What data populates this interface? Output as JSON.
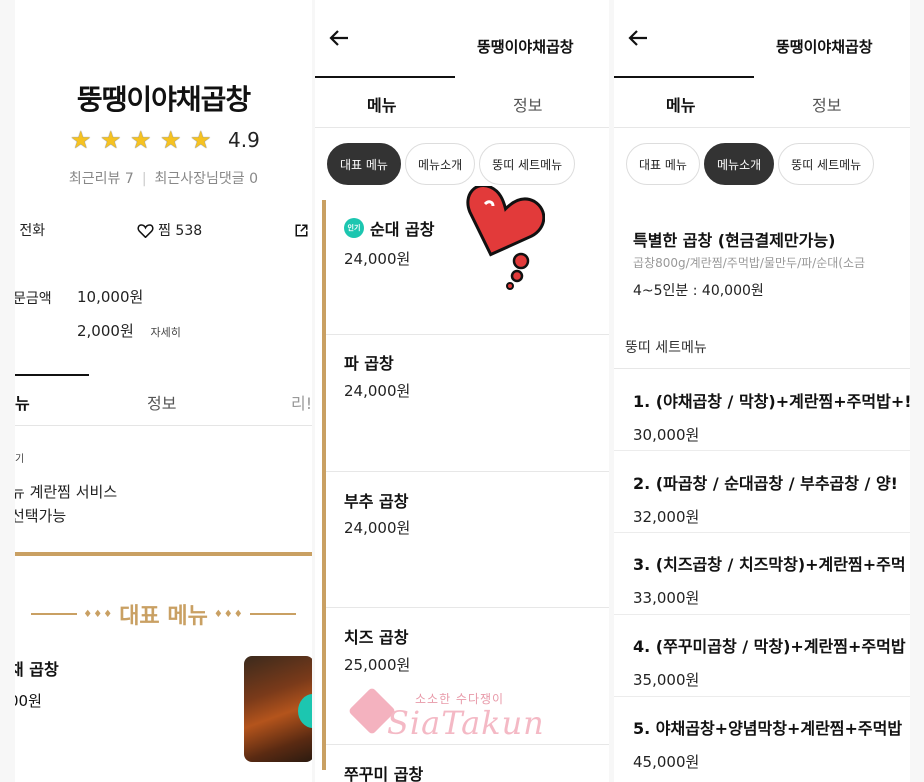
{
  "panel1": {
    "store_title": "뚱땡이야채곱창",
    "rating_score": "4.9",
    "stars": 5,
    "recent_reviews": "최근리뷰 7",
    "owner_comments": "최근사장님댓글 0",
    "actions": {
      "call": "전화",
      "favorite": "찜 538",
      "share": "공"
    },
    "min_order_label": "문금액",
    "min_order_value": "10,000원",
    "delivery_fee": "2,000원",
    "detail_label": "자세히",
    "tabs": [
      "뉴",
      "정보",
      "리!"
    ],
    "notice_small": "기",
    "notice_line1": "뉴 계란찜 서비스",
    "notice_line2": "선택가능",
    "banner_dots_left": "♦♦♦",
    "banner_title": "대표 메뉴",
    "banner_dots_right": "♦♦♦",
    "menu_item_name": "채 곱창",
    "menu_item_price": "00원"
  },
  "panel2": {
    "header_title": "뚱땡이야채곱창",
    "tabs": [
      "메뉴",
      "정보"
    ],
    "chips": [
      "대표 메뉴",
      "메뉴소개",
      "뚱띠 세트메뉴"
    ],
    "selected_chip": 0,
    "popular_badge": "인기",
    "items": [
      {
        "name": "순대 곱창",
        "price": "24,000원"
      },
      {
        "name": "파 곱창",
        "price": "24,000원"
      },
      {
        "name": "부추 곱창",
        "price": "24,000원"
      },
      {
        "name": "치즈 곱창",
        "price": "25,000원"
      },
      {
        "name": "쭈꾸미 곱창",
        "price": ""
      }
    ],
    "watermark_small": "소소한 수다쟁이",
    "watermark_big": "SiaTakun"
  },
  "panel3": {
    "header_title": "뚱땡이야채곱창",
    "tabs": [
      "메뉴",
      "정보"
    ],
    "chips": [
      "대표 메뉴",
      "메뉴소개",
      "뚱띠 세트메뉴"
    ],
    "selected_chip": 1,
    "special_title": "특별한 곱창 (현금결제만가능)",
    "special_desc": "곱창800g/계란찜/주먹밥/물만두/파/순대(소금",
    "special_sub": "4~5인분 : 40,000원",
    "section_title": "뚱띠 세트메뉴",
    "sets": [
      {
        "name": "1. (야채곱창 / 막창)+계란찜+주먹밥+!",
        "price": "30,000원"
      },
      {
        "name": "2. (파곱창 / 순대곱창 / 부추곱창 / 양!",
        "price": "32,000원"
      },
      {
        "name": "3. (치즈곱창 / 치즈막창)+계란찜+주먹",
        "price": "33,000원"
      },
      {
        "name": "4. (쭈꾸미곱창 / 막창)+계란찜+주먹밥",
        "price": "35,000원"
      },
      {
        "name": "5. 야채곱창+양념막창+계란찜+주먹밥",
        "price": "45,000원"
      }
    ]
  },
  "colors": {
    "gold": "#c9a063",
    "star": "#f5c222",
    "chip_selected": "#333333",
    "badge_teal": "#1cc6b0",
    "heart": "#e23a3a"
  }
}
